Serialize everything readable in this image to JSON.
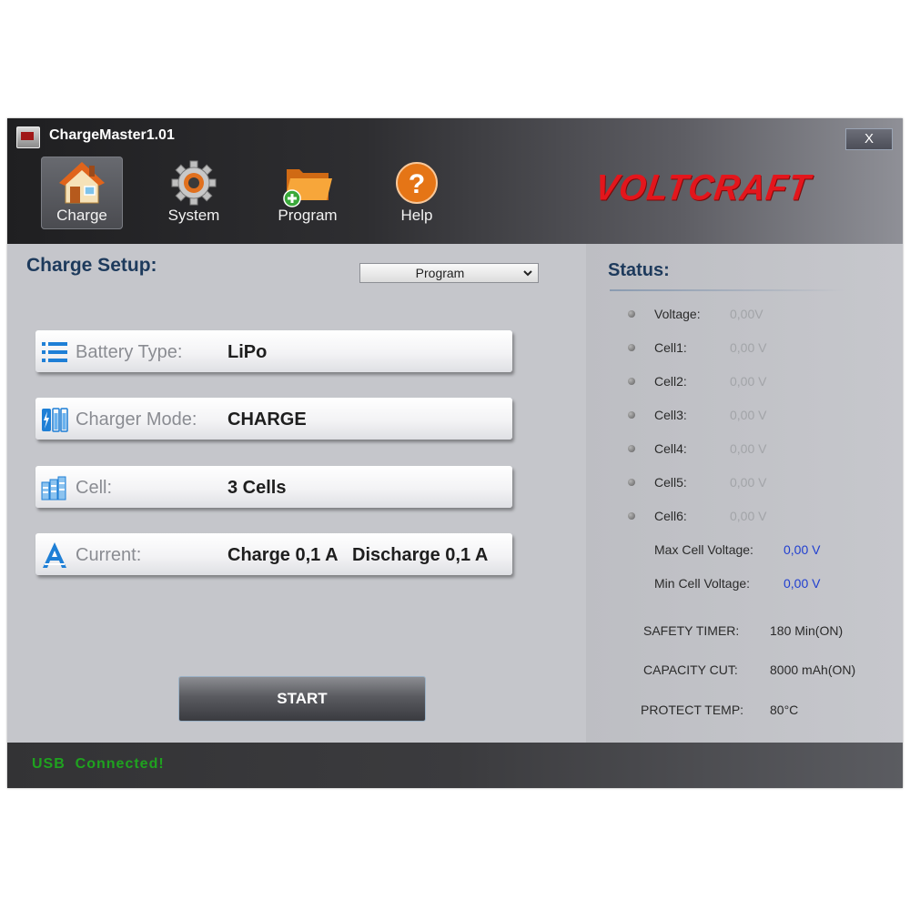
{
  "window": {
    "title": "ChargeMaster1.01",
    "close_label": "X"
  },
  "toolbar": {
    "items": [
      {
        "label": "Charge",
        "icon": "house-icon",
        "active": true
      },
      {
        "label": "System",
        "icon": "gear-icon",
        "active": false
      },
      {
        "label": "Program",
        "icon": "folder-add-icon",
        "active": false
      },
      {
        "label": "Help",
        "icon": "help-icon",
        "active": false
      }
    ],
    "logo": "VOLTCRAFT"
  },
  "setup": {
    "title": "Charge Setup:",
    "program_select": {
      "value": "Program"
    },
    "rows": [
      {
        "label": "Battery Type:",
        "value": "LiPo",
        "icon": "list-icon"
      },
      {
        "label": "Charger Mode:",
        "value": "CHARGE",
        "icon": "battery-icon"
      },
      {
        "label": "Cell:",
        "value": "3 Cells",
        "icon": "cells-icon"
      },
      {
        "label": "Current:",
        "value": "Charge 0,1 A",
        "value2": "Discharge 0,1 A",
        "icon": "ampere-icon"
      }
    ],
    "start_label": "START"
  },
  "status": {
    "title": "Status:",
    "readings": [
      {
        "label": "Voltage:",
        "value": "0,00V"
      },
      {
        "label": "Cell1:",
        "value": "0,00 V"
      },
      {
        "label": "Cell2:",
        "value": "0,00 V"
      },
      {
        "label": "Cell3:",
        "value": "0,00 V"
      },
      {
        "label": "Cell4:",
        "value": "0,00 V"
      },
      {
        "label": "Cell5:",
        "value": "0,00 V"
      },
      {
        "label": "Cell6:",
        "value": "0,00 V"
      }
    ],
    "max_cell": {
      "label": "Max Cell Voltage:",
      "value": "0,00 V"
    },
    "min_cell": {
      "label": "Min Cell Voltage:",
      "value": "0,00 V"
    },
    "safety_timer": {
      "label": "SAFETY TIMER:",
      "value": "180 Min(ON)"
    },
    "capacity_cut": {
      "label": "CAPACITY CUT:",
      "value": "8000 mAh(ON)"
    },
    "protect_temp": {
      "label": "PROTECT TEMP:",
      "value": "80°C"
    }
  },
  "statusbar": {
    "text": "USB  Connected!"
  },
  "colors": {
    "accent_blue": "#1d3a5c",
    "value_blue": "#1f3ed0",
    "usb_green": "#1fa21f",
    "logo_red": "#e3161c"
  }
}
